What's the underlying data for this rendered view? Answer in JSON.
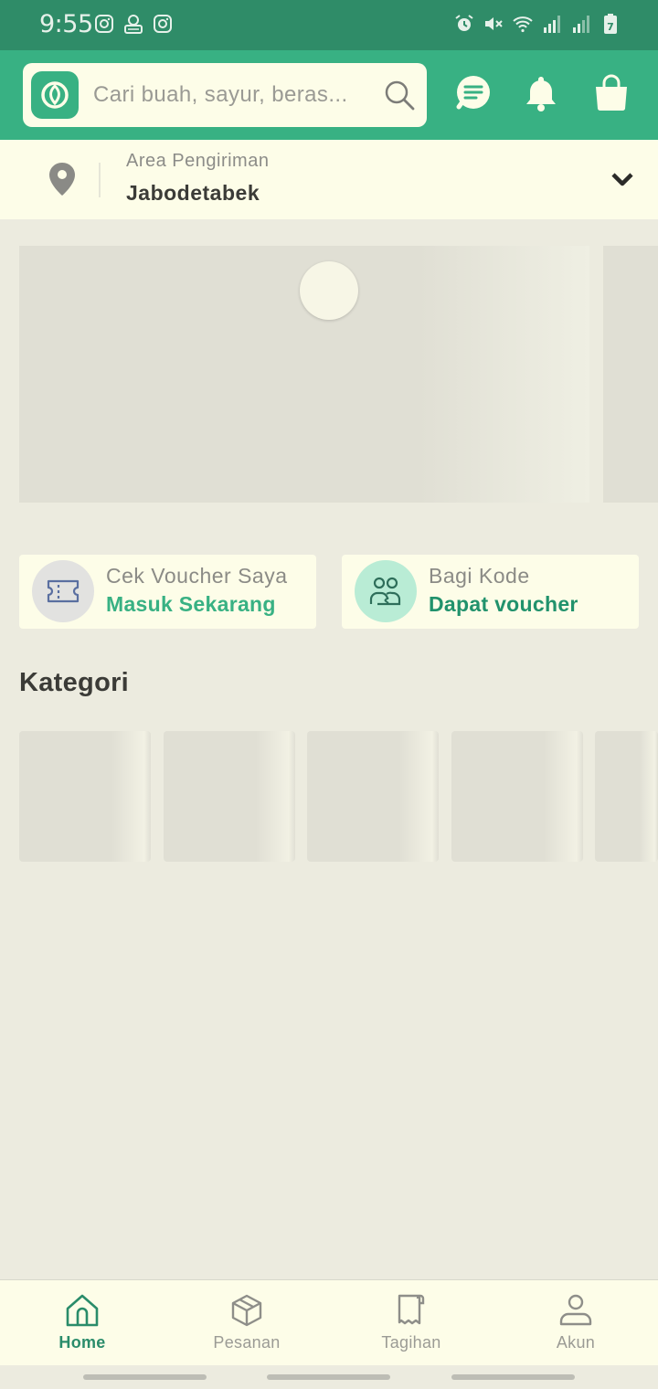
{
  "status_bar": {
    "time": "9:55",
    "left_icons": [
      "instagram-icon",
      "app-notification-icon",
      "instagram-icon"
    ],
    "right_icons": [
      "alarm-icon",
      "mute-icon",
      "wifi-icon",
      "signal-icon",
      "signal-icon",
      "battery-icon"
    ],
    "battery_level": "7"
  },
  "header": {
    "search_placeholder": "Cari buah, sayur, beras...",
    "icons": [
      "chat-icon",
      "bell-icon",
      "shopping-bag-icon"
    ],
    "accent_color": "#38b183"
  },
  "delivery": {
    "label": "Area Pengiriman",
    "value": "Jabodetabek"
  },
  "promos": [
    {
      "title": "Cek Voucher Saya",
      "subtitle": "Masuk Sekarang",
      "icon": "ticket-icon",
      "subtitle_color": "#38b183"
    },
    {
      "title": "Bagi Kode",
      "subtitle": "Dapat voucher",
      "icon": "share-users-icon",
      "subtitle_color": "#21926c"
    }
  ],
  "categories": {
    "title": "Kategori"
  },
  "bottom_nav": {
    "items": [
      {
        "label": "Home",
        "icon": "home-icon",
        "active": true
      },
      {
        "label": "Pesanan",
        "icon": "box-icon",
        "active": false
      },
      {
        "label": "Tagihan",
        "icon": "receipt-icon",
        "active": false
      },
      {
        "label": "Akun",
        "icon": "account-icon",
        "active": false
      }
    ]
  }
}
